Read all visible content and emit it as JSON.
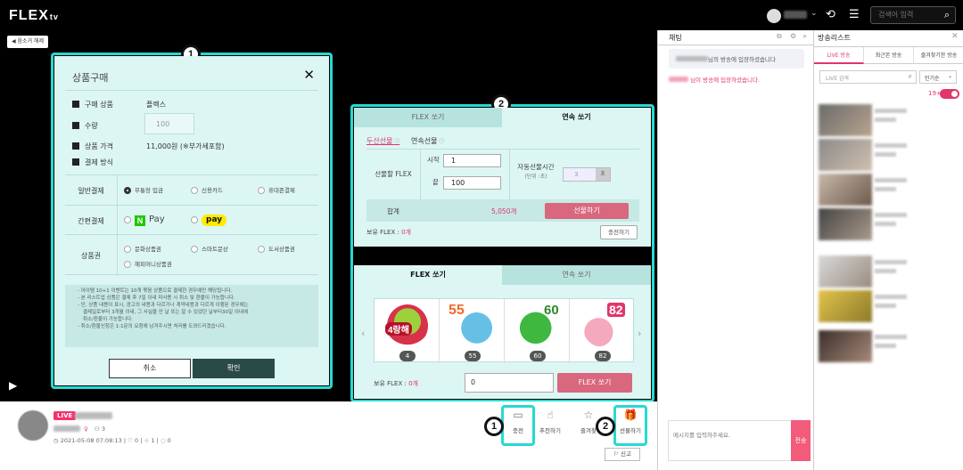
{
  "header": {
    "logo": "FLEX",
    "logo_suffix": "tv",
    "search_placeholder": "검색어 입력"
  },
  "player": {
    "unmute_label": "음소거 해제"
  },
  "purchase_modal": {
    "title": "상품구매",
    "rows": {
      "item_label": "구매 상품",
      "item_value": "플렉스",
      "qty_label": "수량",
      "qty_placeholder": "100",
      "price_label": "상품 가격",
      "price_value": "11,000원 (※부가세포함)",
      "method_label": "결제 방식"
    },
    "general": {
      "label": "일반결제",
      "options": [
        "무통장 입금",
        "신용카드",
        "휴대폰결제"
      ]
    },
    "simple": {
      "label": "간편결제",
      "naver_n": "N",
      "naver_label": "Pay",
      "kakao_label": "pay"
    },
    "voucher": {
      "label": "상품권",
      "options": [
        "문화상품권",
        "스마트문상",
        "도서상품권",
        "해피머니상품권"
      ]
    },
    "notice": [
      "아이템 10+1 이벤트는 10개 묶음 상품으로 결제한 경우에만 해당됩니다.",
      "본 리스트업 상품은 결제 후 7일 이내 미사용 시 취소 및 환불이 가능합니다.",
      "단, 상품 내용이 표시, 광고의 내용과 다르거나 계약내용과 다르게 이행된 경우에는",
      "결제일로부터 3개월 이내, 그 사실을 안 날 또는 알 수 있었던 날부터30일 이내에",
      "취소/환불이 가능합니다.",
      "취소/환불신청은 1:1문의 요청에 남겨주시면 처리를 도와드리겠습니다."
    ],
    "cancel_label": "취소",
    "confirm_label": "확인"
  },
  "gift_top": {
    "tabs": [
      "FLEX 쏘기",
      "연속 쏘기"
    ],
    "subtabs": [
      "두산선물",
      "연속선물"
    ],
    "gift_flex_label": "선물할 FLEX",
    "start_label": "시작",
    "start_value": "1",
    "end_label": "끝",
    "end_value": "100",
    "auto_label": "자동선물시간",
    "auto_unit": "(단위 :초)",
    "auto_value": "3",
    "auto_suffix": "초",
    "total_label": "합계",
    "total_value": "5,050개",
    "gift_button": "선물하기",
    "have_label": "보유 FLEX :",
    "have_value": "0개",
    "charge_button": "충전하기"
  },
  "gift_bottom": {
    "tabs": [
      "FLEX 쏘기",
      "연속 쏘기"
    ],
    "stickers": [
      {
        "text": "4랑해",
        "count": "4"
      },
      {
        "text": "55",
        "count": "55"
      },
      {
        "text": "60",
        "count": "60"
      },
      {
        "text": "82",
        "count": "82"
      }
    ],
    "have_label": "보유 FLEX :",
    "have_value": "0개",
    "input_value": "0",
    "shoot_button": "FLEX 쏘기"
  },
  "highlights": {
    "badge1": "1",
    "badge2": "2"
  },
  "stream_info": {
    "live_tag": "LIVE",
    "viewer_icon_count": "3",
    "date": "2021-05-08 07:08:13",
    "likes": "0",
    "stars": "1",
    "shares": "0"
  },
  "actions": {
    "charge": "충전",
    "recommend": "추천하기",
    "favorite": "즐겨찾",
    "gift": "선물하기",
    "report": "신고"
  },
  "chat": {
    "title": "채팅",
    "welcome_suffix": "님의 방송에 입장하셨습니다",
    "msg_suffix": "님이 방송에 입장하셨습니다.",
    "input_placeholder": "메시지를 입력하주세요.",
    "send_label": "전송"
  },
  "broadcast_list": {
    "title": "방송리스트",
    "tabs": [
      "LIVE 방송",
      "최근본 방송",
      "즐겨찾기한 방송"
    ],
    "search_placeholder": "LIVE 검색",
    "sort_value": "인기순",
    "age_label": "19+"
  }
}
